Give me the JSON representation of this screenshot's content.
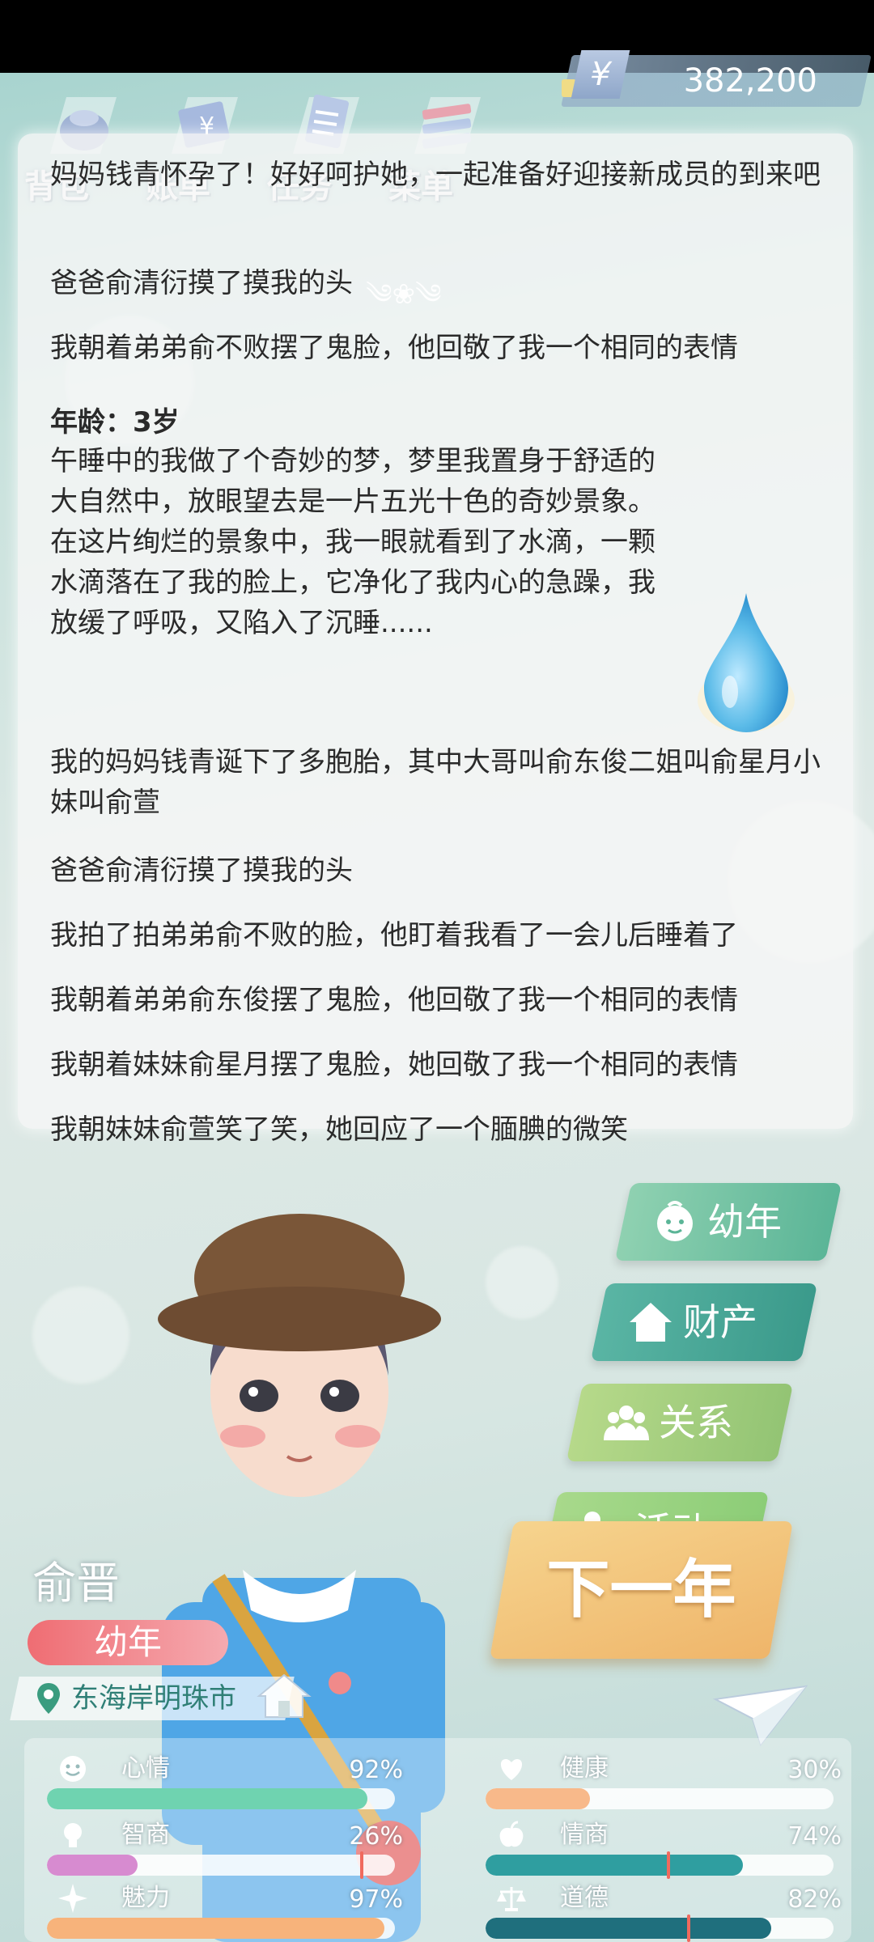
{
  "top_menu": [
    {
      "label": "背包",
      "icon": "backpack-icon"
    },
    {
      "label": "账单",
      "icon": "bill-icon"
    },
    {
      "label": "任务",
      "icon": "task-icon"
    },
    {
      "label": "菜单",
      "icon": "menu-icon"
    }
  ],
  "currency": {
    "symbol": "¥",
    "value": "382,200"
  },
  "log": {
    "entries": [
      "妈妈钱青怀孕了！好好呵护她，一起准备好迎接新成员的到来吧",
      "爸爸俞清衍摸了摸我的头",
      "我朝着弟弟俞不败摆了鬼脸，他回敬了我一个相同的表情",
      "我的妈妈钱青诞下了多胞胎，其中大哥叫俞东俊二姐叫俞星月小妹叫俞萱",
      "爸爸俞清衍摸了摸我的头",
      "我拍了拍弟弟俞不败的脸，他盯着我看了一会儿后睡着了",
      "我朝着弟弟俞东俊摆了鬼脸，他回敬了我一个相同的表情",
      "我朝着妹妹俞星月摆了鬼脸，她回敬了我一个相同的表情",
      "我朝妹妹俞萱笑了笑，她回应了一个腼腆的微笑"
    ],
    "age_heading": "年龄：3岁",
    "dream_text": "午睡中的我做了个奇妙的梦，梦里我置身于舒适的大自然中，放眼望去是一片五光十色的奇妙景象。在这片绚烂的景象中，我一眼就看到了水滴，一颗水滴落在了我的脸上，它净化了我内心的急躁，我放缓了呼吸，又陷入了沉睡......",
    "dream_icon": "water-drop-icon"
  },
  "actions": [
    {
      "label": "幼年",
      "icon": "baby-face-icon",
      "color": "#7cc7a6"
    },
    {
      "label": "财产",
      "icon": "house-icon",
      "color": "#4fa898"
    },
    {
      "label": "关系",
      "icon": "people-icon",
      "color": "#a9cf7e"
    },
    {
      "label": "活动",
      "icon": "molecule-icon",
      "color": "#9bd07f"
    }
  ],
  "next_year_label": "下一年",
  "character": {
    "name": "俞晋",
    "stage": "幼年",
    "location": "东海岸明珠市"
  },
  "stats": [
    {
      "label": "心情",
      "value": "92%",
      "level": 0.92,
      "icon": "smiley-icon",
      "color": "#6fd3b0"
    },
    {
      "label": "健康",
      "value": "30%",
      "level": 0.3,
      "icon": "heart-icon",
      "color": "#f8b98a"
    },
    {
      "label": "智商",
      "value": "26%",
      "level": 0.26,
      "icon": "lightbulb-icon",
      "color": "#d78bd0"
    },
    {
      "label": "情商",
      "value": "74%",
      "level": 0.74,
      "icon": "apple-icon",
      "color": "#2f9ea0"
    },
    {
      "label": "魅力",
      "value": "97%",
      "level": 0.97,
      "icon": "sparkle-icon",
      "color": "#f7b37b"
    },
    {
      "label": "道德",
      "value": "82%",
      "level": 0.82,
      "icon": "scale-icon",
      "color": "#1f6f7d"
    }
  ]
}
